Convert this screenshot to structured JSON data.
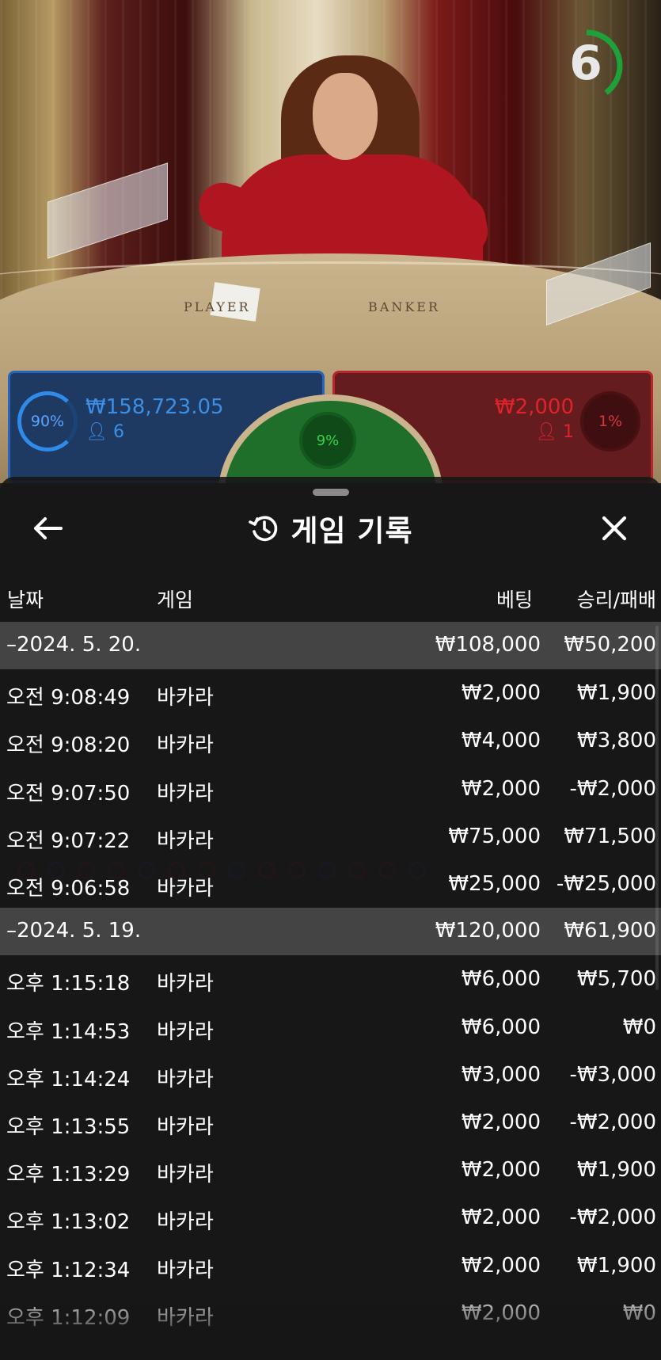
{
  "video": {
    "table_player_text": "PLAYER",
    "table_banker_text": "BANKER",
    "countdown": "6",
    "countdown_fraction": 0.4
  },
  "betting": {
    "player": {
      "percent": "90%",
      "amount": "₩158,723.05",
      "players": "6",
      "color": "#2f8bea"
    },
    "tie": {
      "percent": "9%",
      "color": "#37d24a"
    },
    "banker": {
      "percent": "1%",
      "amount": "₩2,000",
      "players": "1",
      "color": "#e0232a"
    }
  },
  "history": {
    "title": "게임 기록",
    "icons": {
      "back": "arrow-left-icon",
      "history": "history-clock-icon",
      "close": "close-x-icon"
    },
    "columns": {
      "date": "날짜",
      "game": "게임",
      "bet": "베팅",
      "result": "승리/패배"
    },
    "days": [
      {
        "date": "–2024. 5. 20.",
        "bet_total": "₩108,000",
        "result_total": "₩50,200",
        "rows": [
          {
            "time": "오전 9:08:49",
            "game": "바카라",
            "bet": "₩2,000",
            "result": "₩1,900"
          },
          {
            "time": "오전 9:08:20",
            "game": "바카라",
            "bet": "₩4,000",
            "result": "₩3,800"
          },
          {
            "time": "오전 9:07:50",
            "game": "바카라",
            "bet": "₩2,000",
            "result": "-₩2,000"
          },
          {
            "time": "오전 9:07:22",
            "game": "바카라",
            "bet": "₩75,000",
            "result": "₩71,500"
          },
          {
            "time": "오전 9:06:58",
            "game": "바카라",
            "bet": "₩25,000",
            "result": "-₩25,000"
          }
        ]
      },
      {
        "date": "–2024. 5. 19.",
        "bet_total": "₩120,000",
        "result_total": "₩61,900",
        "rows": [
          {
            "time": "오후 1:15:18",
            "game": "바카라",
            "bet": "₩6,000",
            "result": "₩5,700"
          },
          {
            "time": "오후 1:14:53",
            "game": "바카라",
            "bet": "₩6,000",
            "result": "₩0"
          },
          {
            "time": "오후 1:14:24",
            "game": "바카라",
            "bet": "₩3,000",
            "result": "-₩3,000"
          },
          {
            "time": "오후 1:13:55",
            "game": "바카라",
            "bet": "₩2,000",
            "result": "-₩2,000"
          },
          {
            "time": "오후 1:13:29",
            "game": "바카라",
            "bet": "₩2,000",
            "result": "₩1,900"
          },
          {
            "time": "오후 1:13:02",
            "game": "바카라",
            "bet": "₩2,000",
            "result": "-₩2,000"
          },
          {
            "time": "오후 1:12:34",
            "game": "바카라",
            "bet": "₩2,000",
            "result": "₩1,900"
          },
          {
            "time": "오후 1:12:09",
            "game": "바카라",
            "bet": "₩2,000",
            "result": "₩0"
          }
        ]
      }
    ]
  }
}
